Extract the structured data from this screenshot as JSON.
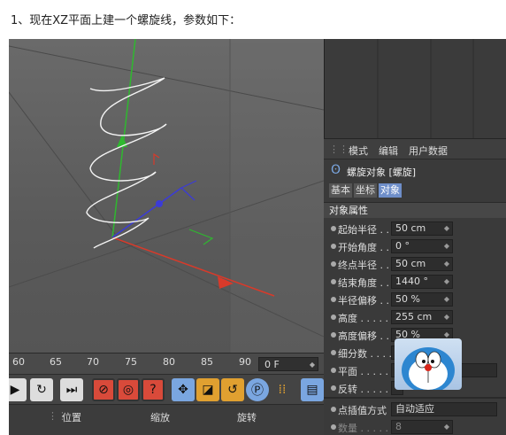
{
  "caption": "1、现在XZ平面上建一个螺旋线，参数如下：",
  "timeline": {
    "ticks": [
      "60",
      "65",
      "70",
      "75",
      "80",
      "85",
      "90"
    ],
    "frame_value": "0 F"
  },
  "coord_header": {
    "position": "位置",
    "scale": "缩放",
    "rotation": "旋转"
  },
  "panel": {
    "menu": [
      "模式",
      "编辑",
      "用户数据"
    ],
    "object_title": "螺旋对象 [螺旋]",
    "tabs": [
      "基本",
      "坐标",
      "对象"
    ],
    "active_tab": "对象",
    "section": "对象属性",
    "properties": [
      {
        "label": "起始半径 . .",
        "value": "50 cm"
      },
      {
        "label": "开始角度 . .",
        "value": "0 °"
      },
      {
        "label": "终点半径 . .",
        "value": "50 cm"
      },
      {
        "label": "结束角度 . .",
        "value": "1440 °"
      },
      {
        "label": "半径偏移 . .",
        "value": "50 %"
      },
      {
        "label": "高度 . . . . .",
        "value": "255 cm"
      },
      {
        "label": "高度偏移 . .",
        "value": "50 %"
      },
      {
        "label": "细分数 . . . .",
        "value": ""
      },
      {
        "label": "平面 . . . . .",
        "value": ""
      },
      {
        "label": "反转 . . . . .",
        "value": ""
      }
    ],
    "interpolation": {
      "label": "点插值方式",
      "value": "自动适应"
    },
    "count": {
      "label": "数量 . . . . .",
      "value": "8"
    }
  },
  "colors": {
    "active_tab": "#6e8ec9",
    "y_axis": "#2fb82f",
    "x_axis": "#d83a2a",
    "z_axis": "#3b3bd8"
  }
}
